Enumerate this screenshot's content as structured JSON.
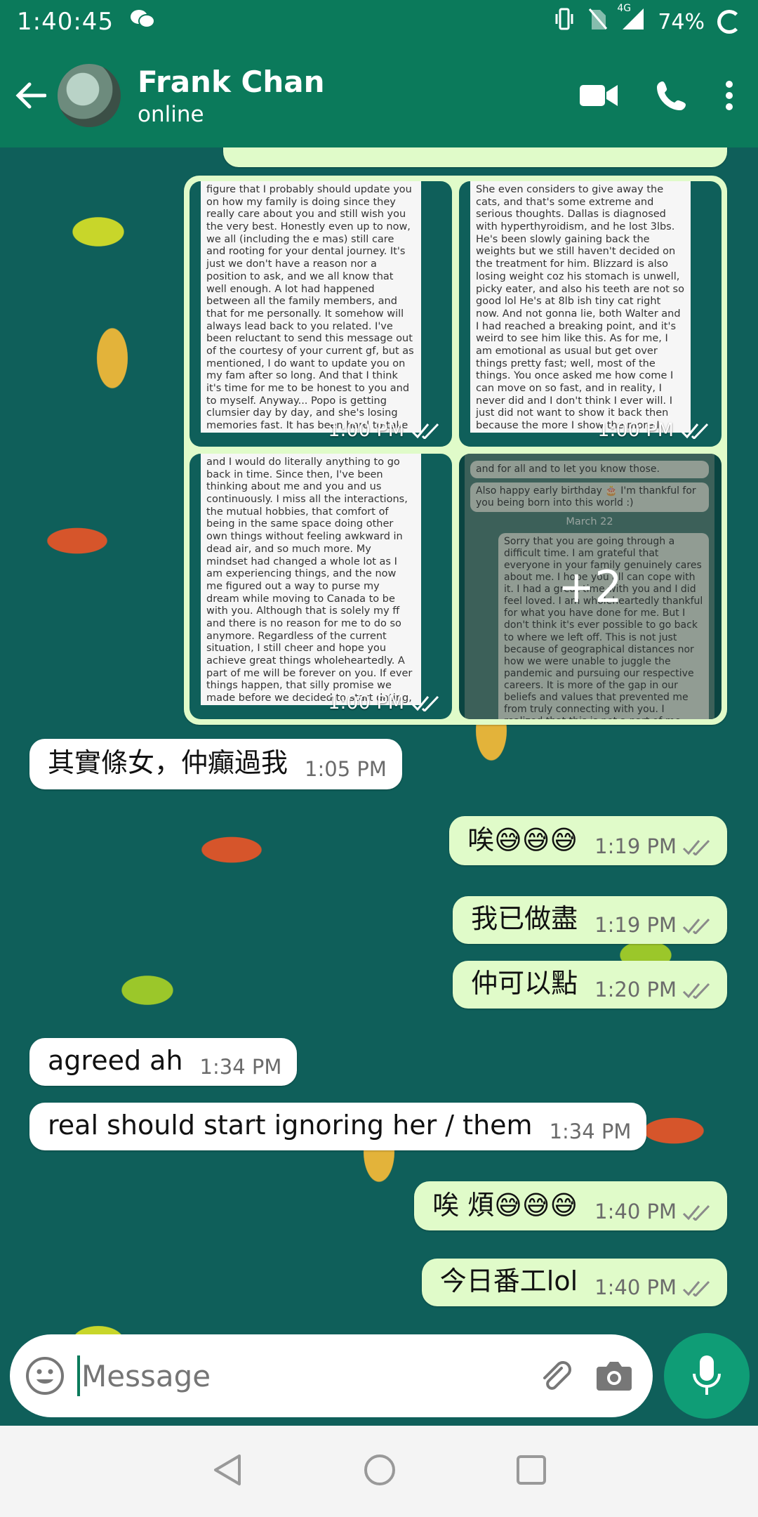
{
  "status_bar": {
    "time": "1:40:45",
    "network": "4G",
    "battery": "74%",
    "icons": [
      "wechat-icon",
      "vibrate-icon",
      "no-sim-icon",
      "signal-icon",
      "battery-ring-icon"
    ]
  },
  "header": {
    "name": "Frank Chan",
    "status": "online",
    "icons": [
      "back-arrow-icon",
      "video-call-icon",
      "phone-icon",
      "more-icon"
    ]
  },
  "photo_group": {
    "thumbs": [
      {
        "time": "1:00 PM",
        "text": "figure that I probably should update you on how my family is doing since they really care about you and still wish you the very best. Honestly even up to now, we all (including the e mas) still care and rooting for your dental journey. It's just we don't have a reason nor a position to ask, and we all know that well enough. A lot had happened between all the family members, and that for me personally. It somehow will always lead back to you related. I've been reluctant to send this message out of the courtesy of your current gf, but as mentioned, I do want to update you on my fam after so long. And that I think it's time for me to be honest to you and to myself. Anyway... Popo is getting clumsier day by day, and she's losing memories fast. It has been hard to take care of her, especially she started refusing to eat. There's lot of constrains on the e mas so I took on the just 308 taking care of popo, and there was a"
      },
      {
        "time": "1:00 PM",
        "text": "She even considers to give away the cats, and that's some extreme and serious thoughts. Dallas is diagnosed with hyperthyroidism, and he lost 3lbs. He's been slowly gaining back the weights but we still haven't decided on the treatment for him. Blizzard is also losing weight coz his stomach is unwell, picky eater, and also his teeth are not so good lol He's at 8lb ish tiny cat right now. And not gonna lie, both Walter and I had reached a breaking point, and it's weird to see him like this. As for me, I am emotional as usual but get over things pretty fast; well, most of the things. You once asked me how come I can move on so fast, and in reality, I never did and I don't think I ever will. I just did not want to show it back then because the more I show the more I struggle. I still fluctuate occasionally, and sometimes it hits me hard. The pandemic really took a toll on me, and the work and school stress made me develop a lot of thoughts and ways. Without distractions"
      },
      {
        "time": "1:00 PM",
        "text": "and I would do literally anything to go back in time. Since then, I've been thinking about me and you and us continuously. I miss all the interactions, the mutual hobbies, that comfort of being in the same space doing other own things without feeling awkward in dead air, and so much more. My mindset had changed a whole lot as I am experiencing things, and the now me figured out a way to purse my dream while moving to Canada to be with you. Although that is solely my ff and there is no reason for me to do so anymore. Regardless of the current situation, I still cheer and hope you achieve great things wholeheartedly. A part of me will be forever on you. If ever things happen, that silly promise we made before we decided to start dating, will still hold true. Maybe one day I can proudly tell you I am dating someone, but until then.... I wish that person is you."
      },
      {
        "more": "+2",
        "line1": "and for all and to let you know those.",
        "line2": "Also happy early birthday 🎂 I'm thankful for you being born into this world :)",
        "date": "March 22",
        "text": "Sorry that you are going through a difficult time. I am grateful that everyone in your family genuinely cares about me. I hope you all can cope with it. I had a great time with you and I did feel loved. I am wholeheartedly thankful for what you have done for me. But I don't think it's ever possible to go back to where we left off. This is not just because of geographical distances nor how we were unable to juggle the pandemic and pursuing our respective careers. It is more of the gap in our beliefs and values that prevented me from truly connecting with you. I realized that this is not a part of me that I want to compromise in order to be in a relationship."
      }
    ]
  },
  "messages": [
    {
      "dir": "in",
      "text": "其實條女，仲癲過我",
      "time": "1:05 PM"
    },
    {
      "dir": "out",
      "text": "唉😅😅😅",
      "time": "1:19 PM"
    },
    {
      "dir": "out",
      "text": "我已做盡",
      "time": "1:19 PM"
    },
    {
      "dir": "out",
      "text": "仲可以點",
      "time": "1:20 PM"
    },
    {
      "dir": "in",
      "text": "agreed ah",
      "time": "1:34 PM"
    },
    {
      "dir": "in",
      "text": "real should start ignoring her / them",
      "time": "1:34 PM"
    },
    {
      "dir": "out",
      "text": "唉 煩😅😅😅",
      "time": "1:40 PM"
    },
    {
      "dir": "out",
      "text": "今日番工lol",
      "time": "1:40 PM"
    }
  ],
  "composer": {
    "placeholder": "Message",
    "icons": [
      "emoji-icon",
      "attach-icon",
      "camera-icon",
      "mic-icon"
    ]
  },
  "nav": {
    "icons": [
      "back-nav-icon",
      "home-nav-icon",
      "recents-nav-icon"
    ]
  },
  "colors": {
    "header": "#0b7a5b",
    "outgoing": "#e0fbc9",
    "incoming": "#ffffff",
    "mic": "#0f9d76"
  }
}
